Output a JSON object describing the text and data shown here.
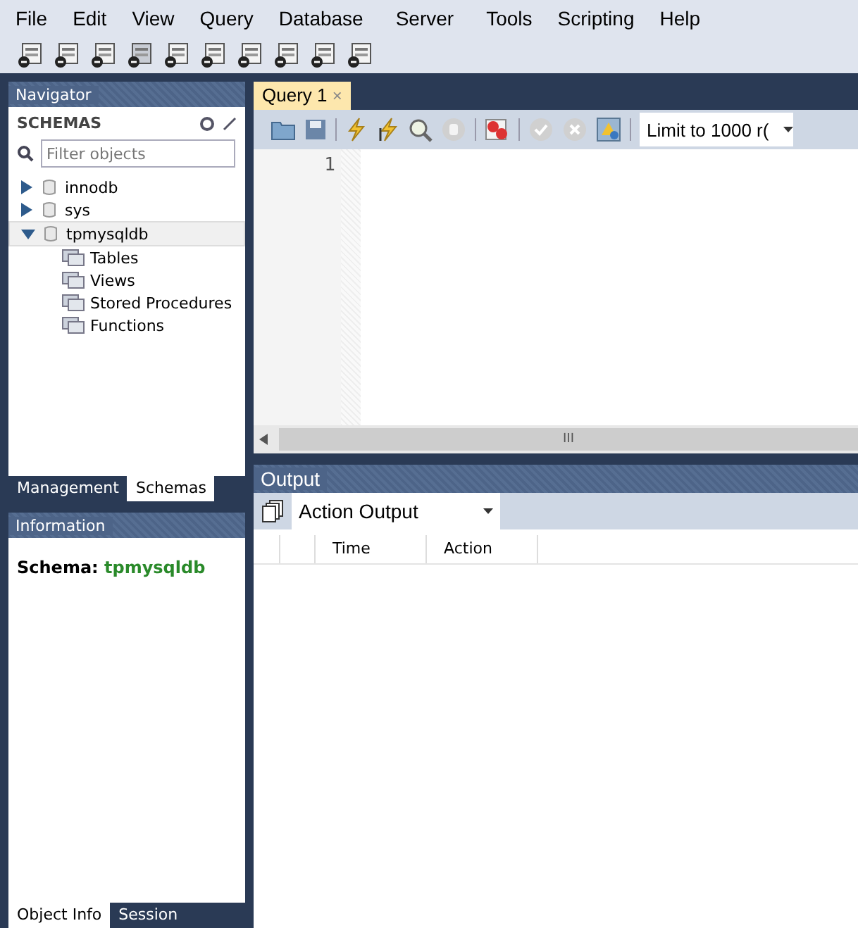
{
  "menu": [
    "File",
    "Edit",
    "View",
    "Query",
    "Database",
    "Server",
    "Tools",
    "Scripting",
    "Help"
  ],
  "navigator": {
    "title": "Navigator",
    "section": "SCHEMAS",
    "filter": {
      "placeholder": "Filter objects"
    },
    "tree": [
      {
        "label": "innodb",
        "expanded": false,
        "selected": false
      },
      {
        "label": "sys",
        "expanded": false,
        "selected": false
      },
      {
        "label": "tpmysqldb",
        "expanded": true,
        "selected": true,
        "children": [
          {
            "label": "Tables"
          },
          {
            "label": "Views"
          },
          {
            "label": "Stored Procedures"
          },
          {
            "label": "Functions"
          }
        ]
      }
    ],
    "tabs": [
      {
        "label": "Management",
        "selected": false
      },
      {
        "label": "Schemas",
        "selected": true
      }
    ]
  },
  "information": {
    "title": "Information",
    "schema_label": "Schema:",
    "schema_value": "tpmysqldb",
    "tabs": [
      {
        "label": "Object Info",
        "selected": true
      },
      {
        "label": "Session",
        "selected": false
      }
    ]
  },
  "query_tab": {
    "label": "Query 1",
    "close": "×"
  },
  "limit": {
    "value": "Limit to 1000 r("
  },
  "editor": {
    "line_numbers": [
      "1"
    ],
    "scroll_grip": "III"
  },
  "output": {
    "title": "Output",
    "selector": "Action Output",
    "columns": [
      "Time",
      "Action"
    ]
  }
}
